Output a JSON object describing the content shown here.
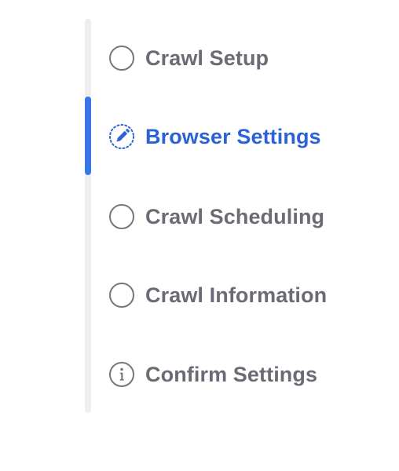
{
  "stepper": {
    "active_index": 1,
    "steps": [
      {
        "label": "Crawl Setup",
        "icon": "empty-circle-icon",
        "state": "pending"
      },
      {
        "label": "Browser Settings",
        "icon": "pencil-dotted-circle-icon",
        "state": "active"
      },
      {
        "label": "Crawl Scheduling",
        "icon": "empty-circle-icon",
        "state": "pending"
      },
      {
        "label": "Crawl Information",
        "icon": "empty-circle-icon",
        "state": "pending"
      },
      {
        "label": "Confirm Settings",
        "icon": "info-circle-icon",
        "state": "info"
      }
    ]
  },
  "colors": {
    "active": "#2b63d6",
    "indicator": "#3b76e8",
    "inactive_text": "#6b6b75",
    "inactive_icon": "#76767e",
    "track": "#eeeeef"
  }
}
